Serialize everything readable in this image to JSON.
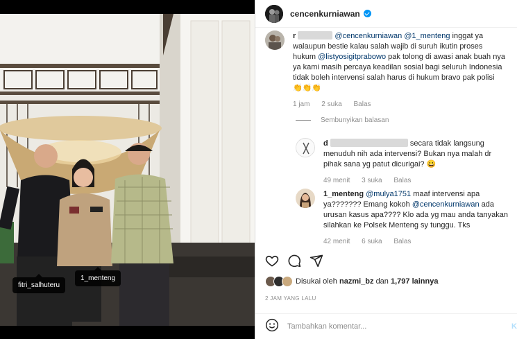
{
  "post": {
    "username": "cencenkurniawan",
    "tags": [
      "fitri_salhuteru",
      "1_menteng"
    ]
  },
  "comments": [
    {
      "user_prefix": "r",
      "mentions": [
        "@cencenkurniawan",
        "@1_menteng"
      ],
      "text_1": "inggat ya",
      "text_2": "walaupun bestie kalau salah wajib di suruh ikutin proses",
      "text_3_prefix": "hukum",
      "text_3_mention": "@listyosigitprabowo",
      "text_3_suffix": "pak tolong di awasi anak buah nya",
      "text_4": "ya kami masih percaya keadilan sosial bagi seluruh Indonesia",
      "text_5": "tidak boleh intervensi salah harus di hukum bravo pak polisi",
      "emoji": "👏👏👏",
      "time": "1 jam",
      "likes": "2 suka",
      "reply": "Balas"
    }
  ],
  "hide_replies": "Sembunyikan balasan",
  "replies": [
    {
      "user_prefix": "d",
      "text_1": "secara tidak langsung",
      "text_2": "menuduh nih ada intervensi? Bukan nya malah dr",
      "text_3": "pihak sana yg patut dicurigai?",
      "emoji": "😀",
      "time": "49 menit",
      "likes": "3 suka",
      "reply": "Balas"
    },
    {
      "username": "1_menteng",
      "mention_1": "@mulya1751",
      "text_1": "maaf intervensi apa",
      "text_2": "ya??????? Emang kokoh",
      "mention_2": "@cencenkurniawan",
      "text_2b": "ada",
      "text_3": "urusan kasus apa???? Klo ada yg mau anda tanyakan",
      "text_4": "silahkan ke Polsek Menteng sy tunggu. Tks",
      "time": "42 menit",
      "likes": "6 suka",
      "reply": "Balas"
    }
  ],
  "likes_line": {
    "prefix": "Disukai oleh",
    "user": "nazmi_bz",
    "middle": "dan",
    "count": "1,797 lainnya"
  },
  "timestamp": "2 JAM YANG LALU",
  "add_comment": {
    "placeholder": "Tambahkan komentar...",
    "post_label": "Ki"
  },
  "icons": [
    "heart-icon",
    "comment-icon",
    "share-icon",
    "emoji-icon"
  ]
}
